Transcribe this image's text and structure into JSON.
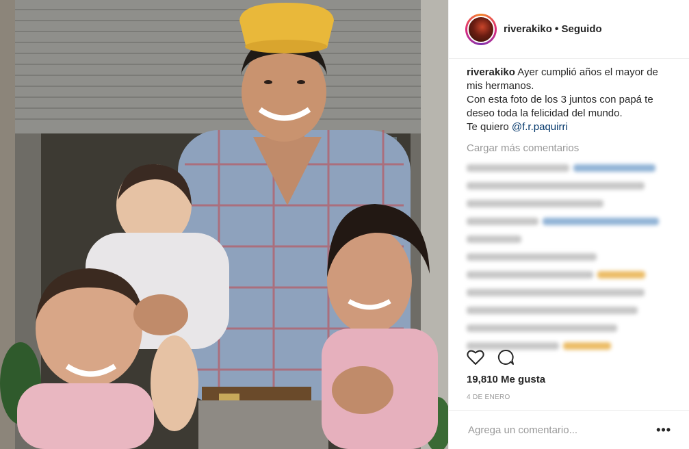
{
  "post": {
    "photo_icon": "family-photo"
  },
  "header": {
    "username": "riverakiko",
    "separator": "•",
    "follow_status": "Seguido"
  },
  "caption": {
    "username": "riverakiko",
    "line1": "Ayer cumplió años el mayor de mis hermanos.",
    "line2": "Con esta foto de los 3 juntos con papá te deseo toda la felicidad del mundo.",
    "line3_prefix": "Te quiero ",
    "mention": "@f.r.paquirri"
  },
  "comments": {
    "load_more_label": "Cargar más comentarios"
  },
  "actions": {
    "like_icon": "heart-icon",
    "comment_icon": "comment-icon"
  },
  "likes": {
    "text": "19,810 Me gusta"
  },
  "date": {
    "text": "4 DE ENERO"
  },
  "add_comment": {
    "placeholder": "Agrega un comentario...",
    "more_label": "•••"
  }
}
